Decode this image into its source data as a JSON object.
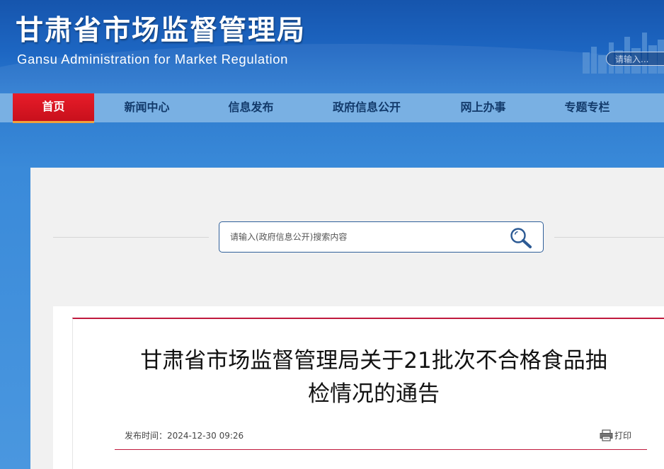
{
  "header": {
    "title_cn": "甘肃省市场监督管理局",
    "title_en": "Gansu Administration for Market Regulation",
    "search_placeholder": "请输入..."
  },
  "nav": {
    "items": [
      {
        "label": "首页",
        "active": true
      },
      {
        "label": "新闻中心"
      },
      {
        "label": "信息发布"
      },
      {
        "label": "政府信息公开"
      },
      {
        "label": "网上办事"
      },
      {
        "label": "专题专栏"
      }
    ]
  },
  "search": {
    "placeholder": "请输入(政府信息公开)搜索内容",
    "icon": "magnifier-icon"
  },
  "article": {
    "title_line1": "甘肃省市场监督管理局关于21批次不合格食品抽",
    "title_line2": "检情况的通告",
    "published_label": "发布时间：",
    "published_value": "2024-12-30 09:26",
    "print_label": "打印",
    "print_icon": "printer-icon"
  },
  "colors": {
    "header_blue": "#1d66c2",
    "nav_bg": "#79b0e3",
    "nav_active": "#d8141f",
    "accent_red": "#c0193d"
  }
}
